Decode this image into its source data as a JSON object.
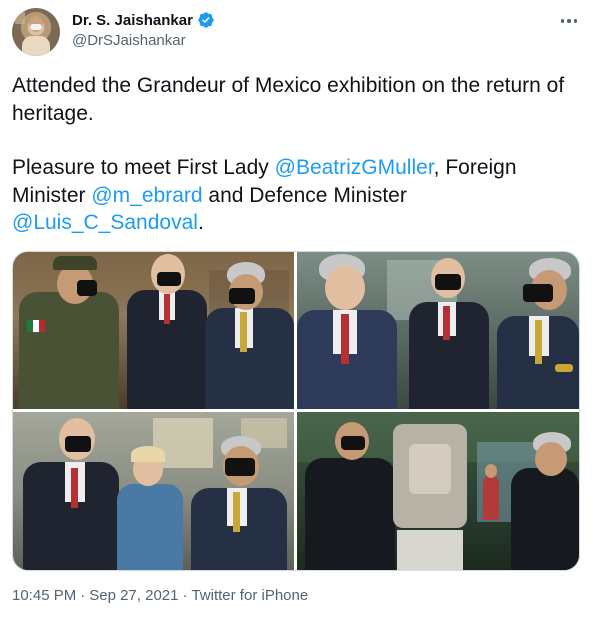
{
  "author": {
    "display_name": "Dr. S. Jaishankar",
    "handle": "@DrSJaishankar",
    "verified": true,
    "avatar_icon": "profile-avatar"
  },
  "more_icon": "more-options-icon",
  "text": {
    "para1": "Attended the Grandeur of Mexico exhibition on the return of heritage.",
    "para2_a": "Pleasure to meet First Lady ",
    "mention1": "@BeatrizGMuller",
    "para2_b": ", Foreign Minister ",
    "mention2": "@m_ebrard",
    "para2_c": " and Defence Minister ",
    "mention3": "@Luis_C_Sandoval",
    "para2_d": "."
  },
  "media": {
    "count": 4,
    "photos": [
      "photo-1",
      "photo-2",
      "photo-3",
      "photo-4"
    ]
  },
  "meta": {
    "time": "10:45 PM",
    "separator": "·",
    "date": "Sep 27, 2021",
    "source": "Twitter for iPhone"
  },
  "colors": {
    "link": "#1d9bf0",
    "text": "#0f1419",
    "secondary": "#536471",
    "verified": "#1d9bf0"
  }
}
